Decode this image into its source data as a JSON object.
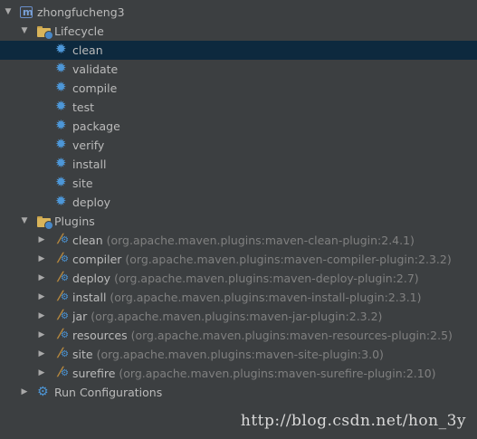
{
  "project": {
    "name": "zhongfucheng3"
  },
  "lifecycle": {
    "label": "Lifecycle",
    "goals": [
      "clean",
      "validate",
      "compile",
      "test",
      "package",
      "verify",
      "install",
      "site",
      "deploy"
    ],
    "selected_goal": "clean"
  },
  "plugins": {
    "label": "Plugins",
    "items": [
      {
        "name": "clean",
        "gav": "(org.apache.maven.plugins:maven-clean-plugin:2.4.1)"
      },
      {
        "name": "compiler",
        "gav": "(org.apache.maven.plugins:maven-compiler-plugin:2.3.2)"
      },
      {
        "name": "deploy",
        "gav": "(org.apache.maven.plugins:maven-deploy-plugin:2.7)"
      },
      {
        "name": "install",
        "gav": "(org.apache.maven.plugins:maven-install-plugin:2.3.1)"
      },
      {
        "name": "jar",
        "gav": "(org.apache.maven.plugins:maven-jar-plugin:2.3.2)"
      },
      {
        "name": "resources",
        "gav": "(org.apache.maven.plugins:maven-resources-plugin:2.5)"
      },
      {
        "name": "site",
        "gav": "(org.apache.maven.plugins:maven-site-plugin:3.0)"
      },
      {
        "name": "surefire",
        "gav": "(org.apache.maven.plugins:maven-surefire-plugin:2.10)"
      }
    ]
  },
  "run_configurations": {
    "label": "Run Configurations"
  },
  "watermark": "http://blog.csdn.net/hon_3y",
  "colors": {
    "background": "#3c3f41",
    "selection": "#0d293e",
    "text": "#bbbbbb",
    "gav_text": "#808080",
    "gear_blue": "#4d97d8"
  }
}
